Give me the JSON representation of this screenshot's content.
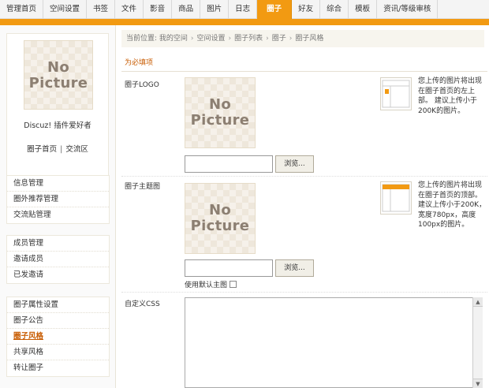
{
  "nav": {
    "tabs": [
      "管理首页",
      "空间设置",
      "书签",
      "文件",
      "影音",
      "商品",
      "图片",
      "日志",
      "圈子",
      "好友",
      "综合",
      "模板",
      "资讯/等级审核"
    ],
    "active": "圈子"
  },
  "sidebar": {
    "avatar_text_1": "No",
    "avatar_text_2": "Picture",
    "profile_name": "Discuz! 插件爱好者",
    "link_home": "圈子首页",
    "link_sep": "|",
    "link_forum": "交流区",
    "groups": [
      [
        "信息管理",
        "圈外推荐管理",
        "交流贴管理"
      ],
      [
        "成员管理",
        "邀请成员",
        "已发邀请"
      ],
      [
        "圈子属性设置",
        "圈子公告",
        "圈子风格",
        "共享风格",
        "转让圈子"
      ]
    ],
    "active_item": "圈子风格"
  },
  "main": {
    "breadcrumb": [
      "当前位置: 我的空间",
      "空间设置",
      "圈子列表",
      "圈子",
      "圈子风格"
    ],
    "breadcrumb_sep": "›",
    "required_label": "为必填项",
    "logo": {
      "label": "圈子LOGO",
      "pic_1": "No",
      "pic_2": "Picture",
      "browse": "浏览...",
      "help": "您上传的图片将出现在圈子首页的左上部。 建议上传小于200K的图片。"
    },
    "banner": {
      "label": "圈子主题图",
      "pic_1": "No",
      "pic_2": "Picture",
      "browse": "浏览...",
      "help": "您上传的图片将出现在圈子首页的顶部。建议上传小于200K，宽度780px，高度100px的图片。",
      "default_label": "使用默认主图"
    },
    "css": {
      "label": "自定义CSS",
      "value": ""
    }
  },
  "colors": {
    "accent": "#f29a12",
    "active_link": "#c85b00"
  }
}
